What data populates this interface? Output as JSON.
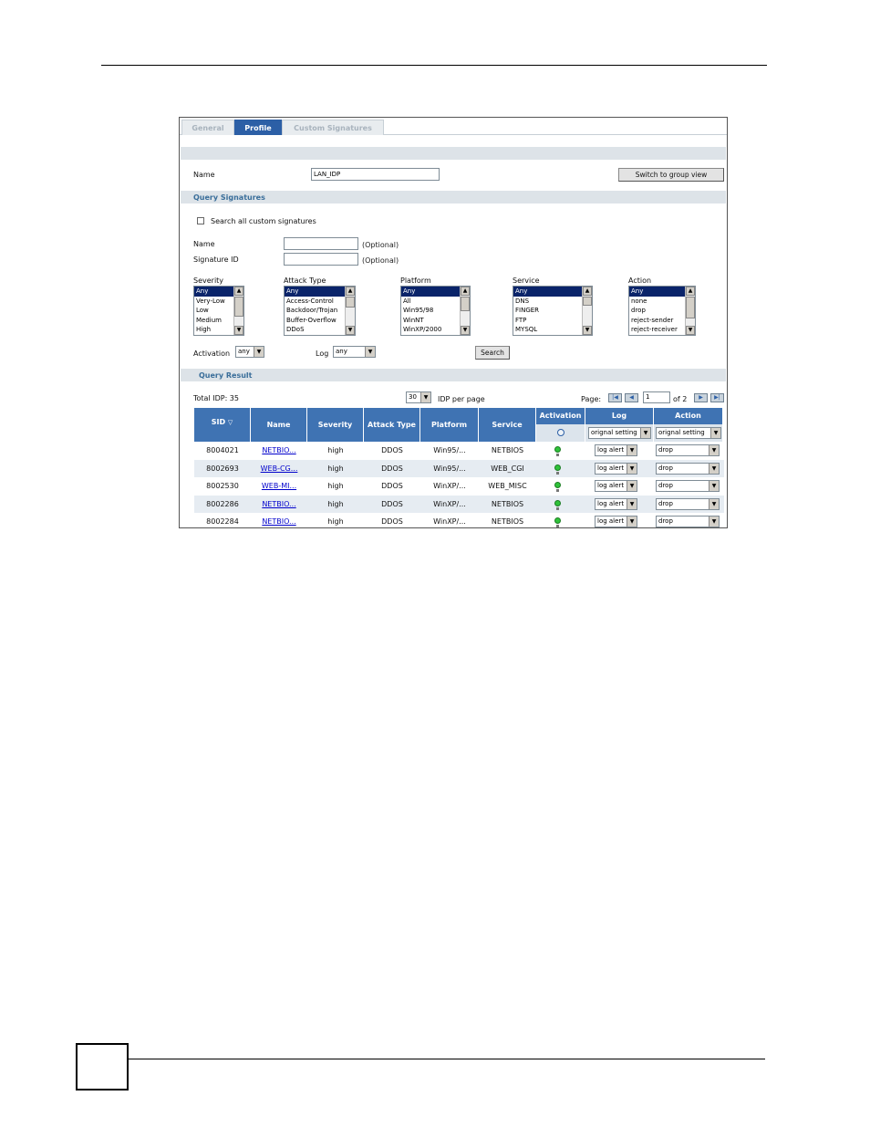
{
  "tabs": [
    {
      "label": "General",
      "active": false
    },
    {
      "label": "Profile",
      "active": true
    },
    {
      "label": "Custom Signatures",
      "active": false
    }
  ],
  "profile": {
    "name_label": "Name",
    "name_value": "LAN_IDP",
    "switch_button": "Switch to group view"
  },
  "query": {
    "title": "Query Signatures",
    "search_all_label": "Search all custom signatures",
    "search_all_checked": false,
    "name_label": "Name",
    "name_value": "",
    "sigid_label": "Signature ID",
    "sigid_value": "",
    "optional": "(Optional)",
    "severity": {
      "label": "Severity",
      "options": [
        "Any",
        "Very-Low",
        "Low",
        "Medium",
        "High"
      ],
      "selected": "Any"
    },
    "attack_type": {
      "label": "Attack Type",
      "options": [
        "Any",
        "Access-Control",
        "Backdoor/Trojan",
        "Buffer-Overflow",
        "DDoS"
      ],
      "selected": "Any"
    },
    "platform": {
      "label": "Platform",
      "options": [
        "Any",
        "All",
        "Win95/98",
        "WinNT",
        "WinXP/2000"
      ],
      "selected": "Any"
    },
    "service": {
      "label": "Service",
      "options": [
        "Any",
        "DNS",
        "FINGER",
        "FTP",
        "MYSQL"
      ],
      "selected": "Any"
    },
    "action": {
      "label": "Action",
      "options": [
        "Any",
        "none",
        "drop",
        "reject-sender",
        "reject-receiver"
      ],
      "selected": "Any"
    },
    "activation_label": "Activation",
    "activation_value": "any",
    "log_label": "Log",
    "log_value": "any",
    "search_button": "Search"
  },
  "result": {
    "title": "Query Result",
    "total_label": "Total IDP: 35",
    "per_page_value": "30",
    "per_page_label": "IDP per page",
    "page_label": "Page:",
    "page_value": "1",
    "page_of": "of 2",
    "columns": {
      "sid": "SID",
      "name": "Name",
      "severity": "Severity",
      "attack_type": "Attack Type",
      "platform": "Platform",
      "service": "Service",
      "activation": "Activation",
      "log": "Log",
      "action": "Action"
    },
    "log_filter": "orignal setting",
    "action_filter": "orignal setting",
    "rows": [
      {
        "sid": "8004021",
        "name": "NETBIO...",
        "severity": "high",
        "attack_type": "DDOS",
        "platform": "Win95/...",
        "service": "NETBIOS",
        "log": "log alert",
        "action": "drop"
      },
      {
        "sid": "8002693",
        "name": "WEB-CG...",
        "severity": "high",
        "attack_type": "DDOS",
        "platform": "Win95/...",
        "service": "WEB_CGI",
        "log": "log alert",
        "action": "drop"
      },
      {
        "sid": "8002530",
        "name": "WEB-MI...",
        "severity": "high",
        "attack_type": "DDOS",
        "platform": "WinXP/...",
        "service": "WEB_MISC",
        "log": "log alert",
        "action": "drop"
      },
      {
        "sid": "8002286",
        "name": "NETBIO...",
        "severity": "high",
        "attack_type": "DDOS",
        "platform": "WinXP/...",
        "service": "NETBIOS",
        "log": "log alert",
        "action": "drop"
      },
      {
        "sid": "8002284",
        "name": "NETBIO...",
        "severity": "high",
        "attack_type": "DDOS",
        "platform": "WinXP/...",
        "service": "NETBIOS",
        "log": "log alert",
        "action": "drop"
      }
    ]
  },
  "icons": {
    "activation": "lightbulb-icon",
    "sort": "sort-down-icon",
    "first": "first-page-icon",
    "prev": "prev-page-icon",
    "next": "next-page-icon",
    "last": "last-page-icon"
  },
  "colors": {
    "header_blue": "#3f73b3",
    "active_tab": "#2c5fa6",
    "section_band": "#dde3e8",
    "section_title": "#3a6e9a",
    "active_bulb": "#2fc23a",
    "link": "#0000cc"
  }
}
